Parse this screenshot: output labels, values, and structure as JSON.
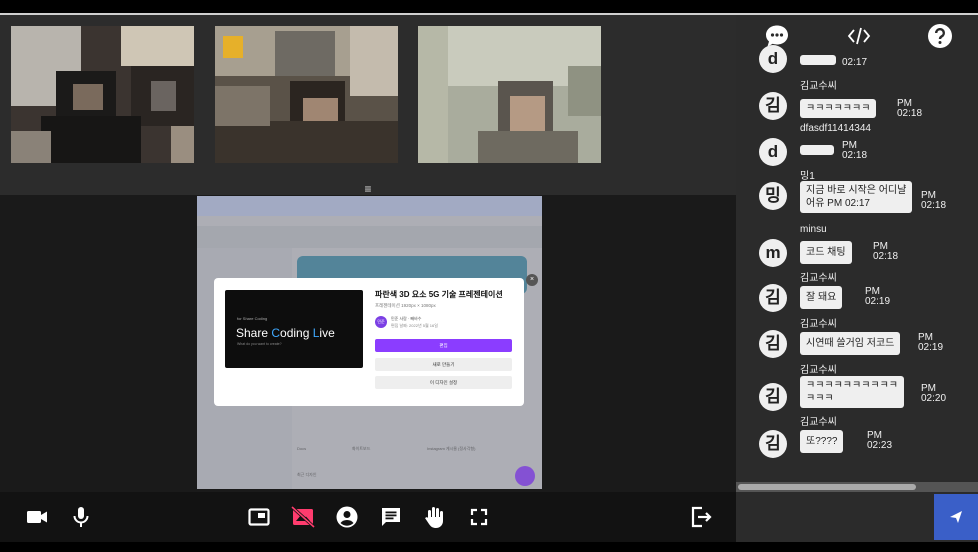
{
  "videos": [
    {
      "name": "participant-1"
    },
    {
      "name": "participant-2"
    },
    {
      "name": "participant-3"
    }
  ],
  "handle_icon": "menu-icon",
  "screen_share": {
    "modal": {
      "preview_small": "for Share Coding",
      "preview_title_a": "Share ",
      "preview_title_b": "C",
      "preview_title_c": "oding ",
      "preview_title_d": "L",
      "preview_title_e": "ive",
      "preview_sub": "What do you want to create?",
      "title": "파란색 3D 요소 5G 기술 프레젠테이션",
      "dims": "프레젠테이션 1920px × 1080px",
      "author": "민준 사람 · 빼바수",
      "date": "편집 날짜: 2022년 5월 16일",
      "edit_label": "편집",
      "new_label": "새로 만들기",
      "view_label": "이 디자인 설정"
    },
    "labels": {
      "a": "Docs",
      "b": "화이트보드",
      "c": "Instagram 게시물 (정사각형)",
      "d": "최근 디자인"
    }
  },
  "toolbar": {
    "buttons": [
      "camera-icon",
      "mic-icon",
      "screen-share-icon",
      "video-off-icon",
      "account-icon",
      "chat-icon",
      "raise-hand-icon",
      "fullscreen-icon",
      "exit-icon"
    ]
  },
  "chat": {
    "header_icons": [
      "chat-bubble-icon",
      "code-icon",
      "help-icon"
    ],
    "messages": [
      {
        "name": "",
        "avatar": "d",
        "text": "",
        "time_top": "",
        "time_bottom": "02:17"
      },
      {
        "name": "김교수씨",
        "avatar": "김",
        "text": "ㅋㅋㅋㅋㅋㅋㅋ",
        "time_top": "PM",
        "time_bottom": "02:18"
      },
      {
        "name": "dfasdf11414344",
        "avatar": "d",
        "text": "",
        "time_top": "PM",
        "time_bottom": "02:18"
      },
      {
        "name": "밍1",
        "avatar": "밍",
        "text_line1": "지금 바로 시작은 어디냘",
        "text_line2": "어유 PM 02:17",
        "time_top": "PM",
        "time_bottom": "02:18"
      },
      {
        "name": "minsu",
        "avatar": "m",
        "text": "코드 채팅",
        "time_top": "PM",
        "time_bottom": "02:18"
      },
      {
        "name": "김교수씨",
        "avatar": "김",
        "text": "잘 돼요",
        "time_top": "PM",
        "time_bottom": "02:19"
      },
      {
        "name": "김교수씨",
        "avatar": "김",
        "text": "시연때 쓸거임 저코드",
        "time_top": "PM",
        "time_bottom": "02:19"
      },
      {
        "name": "김교수씨",
        "avatar": "김",
        "text_line1": "ㅋㅋㅋㅋㅋㅋㅋㅋㅋㅋ",
        "text_line2": "ㅋㅋㅋ",
        "time_top": "PM",
        "time_bottom": "02:20"
      },
      {
        "name": "김교수씨",
        "avatar": "김",
        "text": "또????",
        "time_top": "PM",
        "time_bottom": "02:23"
      }
    ],
    "input_value": "",
    "send_icon": "send-icon"
  },
  "colors": {
    "accent": "#3a5fc8",
    "panel": "#2b2b2b",
    "canva_purple": "#8b3dff",
    "video_off": "#ff3c6e"
  }
}
